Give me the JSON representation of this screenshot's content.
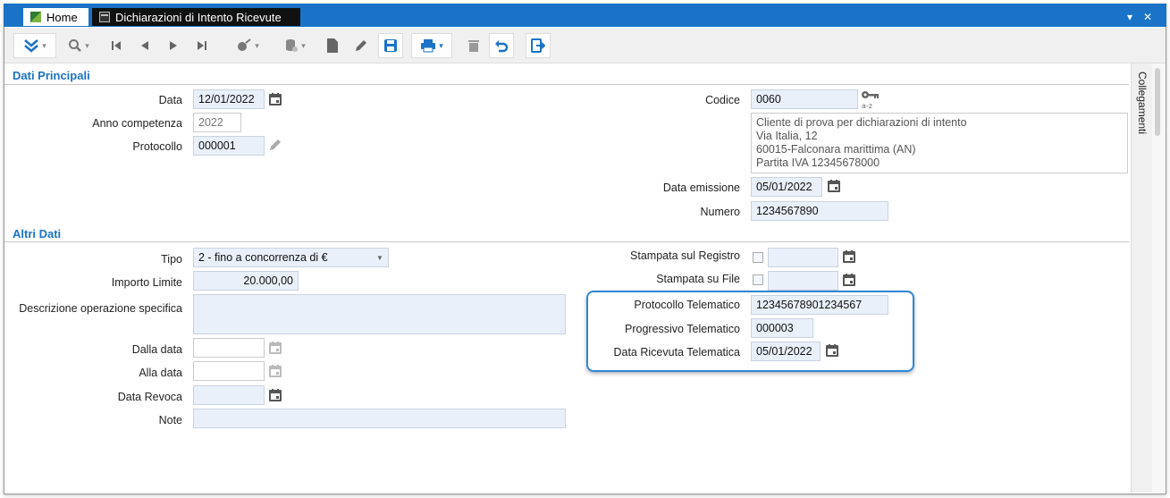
{
  "tabs": [
    {
      "label": "Home"
    },
    {
      "label": "Dichiarazioni di Intento Ricevute"
    }
  ],
  "window_controls": {
    "dropdown": "▾",
    "close": "✕"
  },
  "sections": {
    "main": "Dati Principali",
    "other": "Altri Dati",
    "side": "Collegamenti"
  },
  "left_fields": {
    "data": {
      "label": "Data",
      "value": "12/01/2022"
    },
    "anno": {
      "label": "Anno competenza",
      "value": "2022"
    },
    "protocollo": {
      "label": "Protocollo",
      "value": "000001"
    }
  },
  "right_fields": {
    "codice": {
      "label": "Codice",
      "value": "0060"
    },
    "address": [
      "Cliente di prova per dichiarazioni di intento",
      "Via Italia, 12",
      "60015-Falconara marittima (AN)",
      "Partita IVA 12345678000"
    ],
    "data_emissione": {
      "label": "Data emissione",
      "value": "05/01/2022"
    },
    "numero": {
      "label": "Numero",
      "value": "1234567890"
    }
  },
  "altri": {
    "tipo": {
      "label": "Tipo",
      "value": "2 - fino a concorrenza di €"
    },
    "importo": {
      "label": "Importo Limite",
      "value": "20.000,00"
    },
    "descrizione": {
      "label": "Descrizione operazione specifica",
      "value": ""
    },
    "dalla": {
      "label": "Dalla data",
      "value": ""
    },
    "alla": {
      "label": "Alla data",
      "value": ""
    },
    "revoca": {
      "label": "Data Revoca",
      "value": ""
    },
    "note": {
      "label": "Note",
      "value": ""
    }
  },
  "stampa": {
    "registro": {
      "label": "Stampata sul Registro",
      "value": ""
    },
    "file": {
      "label": "Stampata su File",
      "value": ""
    }
  },
  "telematico": {
    "protocollo": {
      "label": "Protocollo Telematico",
      "value": "12345678901234567"
    },
    "progressivo": {
      "label": "Progressivo Telematico",
      "value": "000003"
    },
    "data_ricevuta": {
      "label": "Data Ricevuta Telematica",
      "value": "05/01/2022"
    }
  },
  "colors": {
    "accent": "#1a73c6",
    "field_bg": "#e9f0fa",
    "highlight": "#2f86d6"
  }
}
